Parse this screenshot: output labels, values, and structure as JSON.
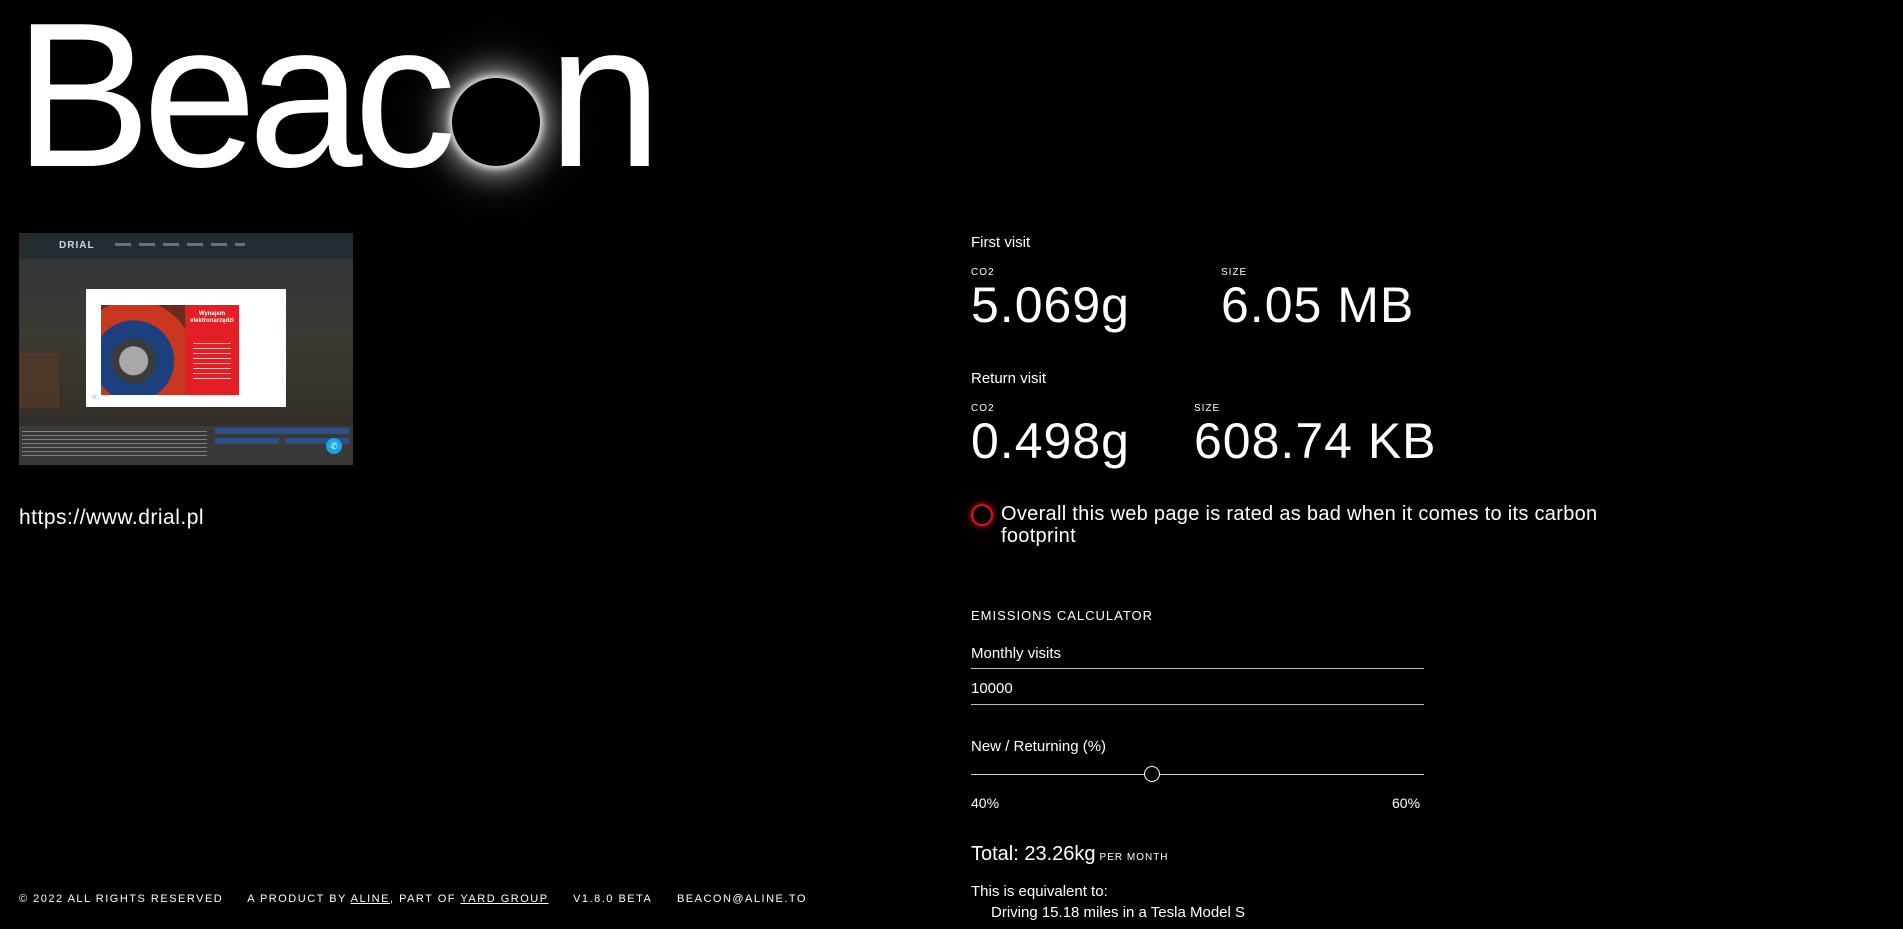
{
  "logo": {
    "text_before": "Beac",
    "text_after": "n"
  },
  "thumbnail": {
    "brand": "DRIAL",
    "popup_heading": "Wynajem elektronarzędzi",
    "phone_icon": "phone-icon",
    "close_icon": "close-icon"
  },
  "site": {
    "url": "https://www.drial.pl"
  },
  "first_visit": {
    "label": "First visit",
    "co2_label": "CO2",
    "co2_value": "5.069g",
    "size_label": "SIZE",
    "size_value": "6.05 MB"
  },
  "return_visit": {
    "label": "Return visit",
    "co2_label": "CO2",
    "co2_value": "0.498g",
    "size_label": "SIZE",
    "size_value": "608.74 KB"
  },
  "rating": {
    "text": "Overall this web page is rated as bad when it comes to its carbon footprint",
    "color": "#e0151b"
  },
  "calculator": {
    "title": "EMISSIONS CALCULATOR",
    "monthly_visits_label": "Monthly visits",
    "monthly_visits_value": "10000",
    "split_label": "New / Returning (%)",
    "split_new": "40%",
    "split_returning": "60%",
    "split_fraction": 0.4,
    "total_label": "Total: 23.26kg",
    "total_unit": "PER MONTH",
    "equivalent_label": "This is equivalent to:",
    "equivalents": [
      "Driving 15.18 miles in a Tesla Model S"
    ]
  },
  "footer": {
    "copyright": "© 2022 ALL RIGHTS RESERVED",
    "product_prefix": "A PRODUCT BY ",
    "aline_link": "ALINE",
    "part_of": ", PART OF ",
    "yard_link": "YARD GROUP",
    "version": "V1.8.0 BETA",
    "email": "BEACON@ALINE.TO"
  }
}
